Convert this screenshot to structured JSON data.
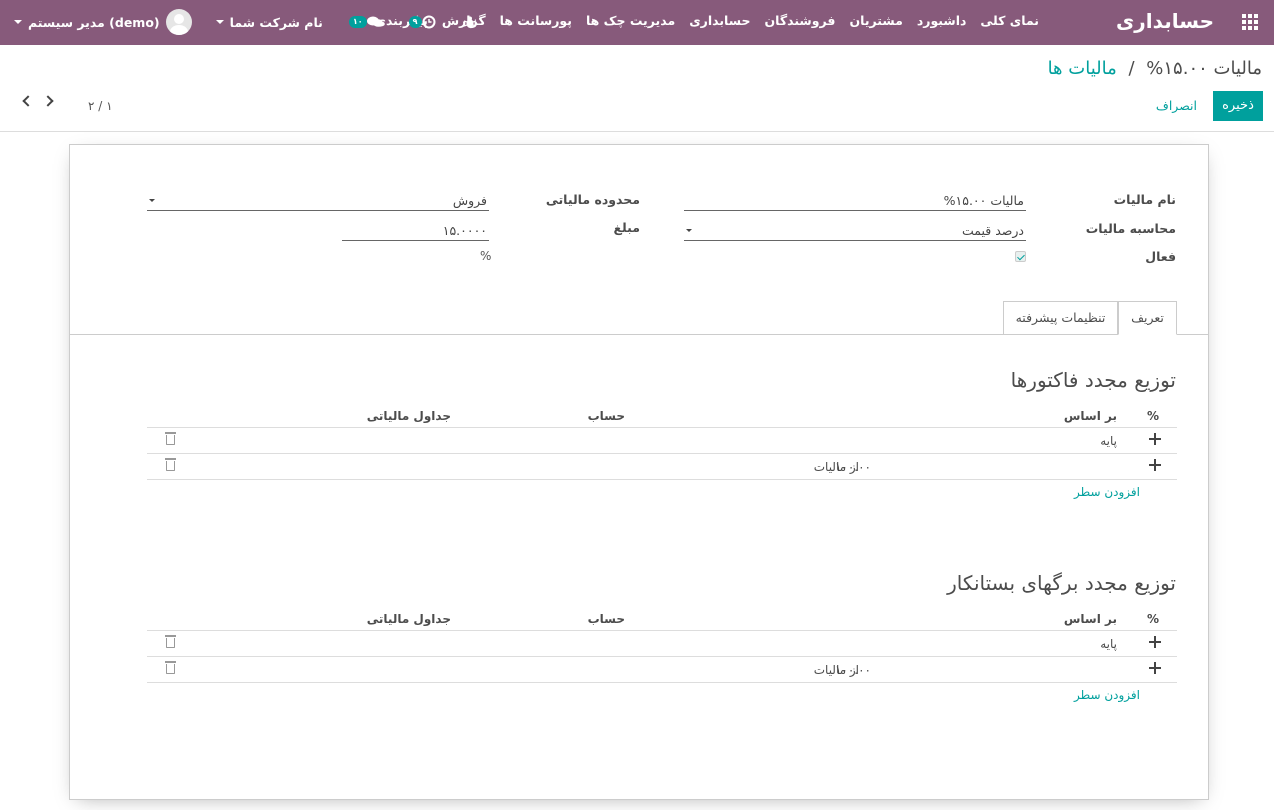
{
  "navbar": {
    "brand": "حسابداری",
    "menu": [
      "نمای کلی",
      "داشبورد",
      "مشتریان",
      "فروشندگان",
      "حسابداری",
      "مدیریت چک ها",
      "پورسانت ها",
      "گزارش",
      "پیکربندی"
    ],
    "user": "مدیر سیستم (demo)",
    "company": "نام شرکت شما",
    "messages_count": "۱۰",
    "activities_count": "۹",
    "icons": {
      "apps": "apps-grid-icon",
      "chat": "chat-icon",
      "clock": "clock-icon",
      "bug": "bug-icon"
    }
  },
  "breadcrumb": {
    "parent": "مالیات ها",
    "separator": "/",
    "current": "مالیات ۱۵.۰۰%"
  },
  "buttons": {
    "save": "ذخیره",
    "discard": "انصراف"
  },
  "pager": {
    "value": "۲ / ۱"
  },
  "form": {
    "tax_name_label": "نام مالیات",
    "tax_name_value": "مالیات ۱۵.۰۰%",
    "tax_computation_label": "محاسبه مالیات",
    "tax_computation_value": "درصد قیمت",
    "active_label": "فعال",
    "active_checked": true,
    "tax_scope_label": "محدوده مالیاتی",
    "tax_scope_value": "فروش",
    "amount_label": "مبلغ",
    "amount_value": "۱۵.۰۰۰۰",
    "amount_unit": "%"
  },
  "tabs": {
    "definition": "تعریف",
    "advanced": "تنظیمات پیشرفته"
  },
  "columns": {
    "percent": "%",
    "based_on": "بر اساس",
    "account": "حساب",
    "tax_grids": "جداول مالیاتی"
  },
  "invoice_section": {
    "title": "توزیع مجدد فاکتورها",
    "rows": [
      {
        "percent": "",
        "based_on": "پایه"
      },
      {
        "percent": "۱۰۰.۰۰",
        "based_on": "از مالیات"
      }
    ],
    "add_line": "افزودن سطر"
  },
  "refund_section": {
    "title": "توزیع مجدد برگهای بستانکار",
    "rows": [
      {
        "percent": "",
        "based_on": "پایه"
      },
      {
        "percent": "۱۰۰.۰۰",
        "based_on": "از مالیات"
      }
    ],
    "add_line": "افزودن سطر"
  },
  "colors": {
    "navbar": "#875a7b",
    "accent": "#00a09d"
  }
}
